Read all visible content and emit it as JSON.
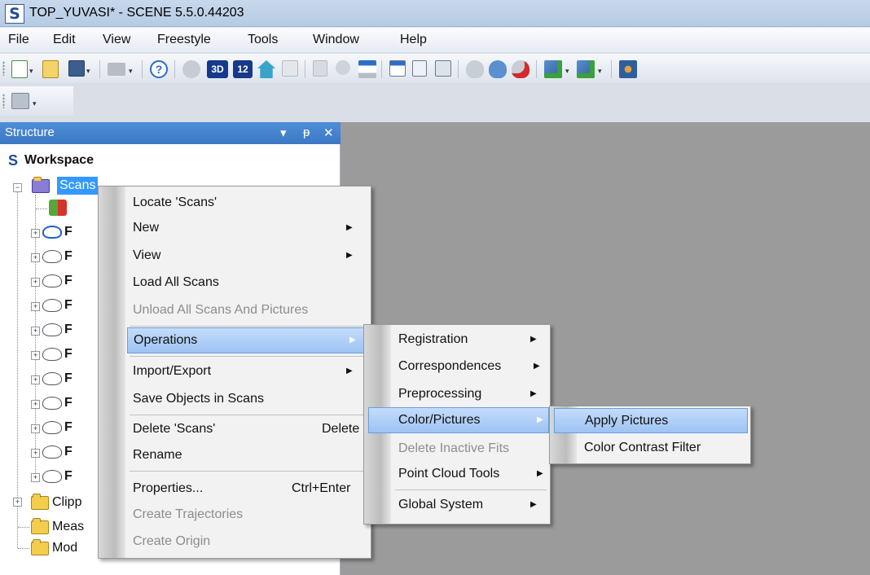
{
  "window": {
    "title": "TOP_YUVASI* - SCENE 5.5.0.44203",
    "logo": "S"
  },
  "menubar": [
    "File",
    "Edit",
    "View",
    "Freestyle",
    "Tools",
    "Window",
    "Help"
  ],
  "toolbar": {
    "btn_3d": "3D",
    "btn_12": "12",
    "help": "?",
    "dropdown": "▾"
  },
  "panel": {
    "title": "Structure",
    "controls": {
      "dropdown": "▾",
      "pin": "ᵽ",
      "close": "✕"
    },
    "tree": {
      "workspace_logo": "S",
      "workspace": "Workspace",
      "scans": "Scans",
      "scan_items": [
        "F",
        "F",
        "F",
        "F",
        "F",
        "F",
        "F",
        "F",
        "F",
        "F",
        "F"
      ],
      "clipping": "Clipp",
      "measurements": "Meas",
      "models": "Mod"
    }
  },
  "context_menu": {
    "items": [
      {
        "label": "Locate 'Scans'"
      },
      {
        "label": "New",
        "submenu": true
      },
      {
        "label": "View",
        "submenu": true
      },
      {
        "label": "Load All Scans"
      },
      {
        "label": "Unload All Scans And Pictures",
        "disabled": true
      },
      {
        "label": "Operations",
        "submenu": true,
        "highlighted": true
      },
      {
        "label": "Import/Export",
        "submenu": true
      },
      {
        "label": "Save Objects in Scans"
      },
      {
        "label": "Delete 'Scans'",
        "shortcut": "Delete"
      },
      {
        "label": "Rename"
      },
      {
        "label": "Properties...",
        "shortcut": "Ctrl+Enter"
      },
      {
        "label": "Create Trajectories",
        "disabled": true
      },
      {
        "label": "Create Origin",
        "disabled": true
      }
    ]
  },
  "operations_menu": {
    "items": [
      {
        "label": "Registration",
        "submenu": true
      },
      {
        "label": "Correspondences",
        "submenu": true
      },
      {
        "label": "Preprocessing",
        "submenu": true
      },
      {
        "label": "Color/Pictures",
        "submenu": true,
        "highlighted": true
      },
      {
        "label": "Delete Inactive Fits",
        "disabled": true
      },
      {
        "label": "Point Cloud Tools",
        "submenu": true
      },
      {
        "label": "Global System",
        "submenu": true
      }
    ]
  },
  "color_menu": {
    "items": [
      {
        "label": "Apply Pictures",
        "highlighted": true
      },
      {
        "label": "Color Contrast Filter"
      }
    ]
  },
  "glyphs": {
    "submenu_arrow": "▶",
    "expand": "+",
    "collapse": "−"
  }
}
